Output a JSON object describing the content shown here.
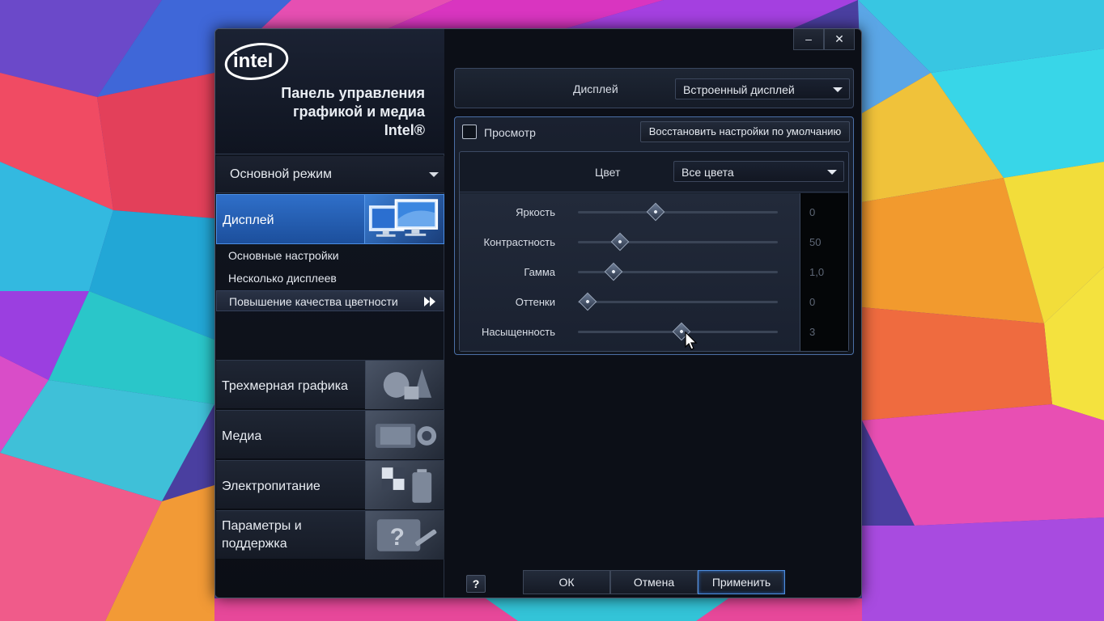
{
  "window": {
    "title_lines": [
      "Панель управления",
      "графикой и медиа",
      "Intel®"
    ],
    "logo_text": "intel",
    "minimize_symbol": "–",
    "close_symbol": "✕"
  },
  "sidebar": {
    "mode_label": "Основной режим",
    "active_section": "Дисплей",
    "sub_items": [
      {
        "label": "Основные настройки",
        "active": false
      },
      {
        "label": "Несколько дисплеев",
        "active": false
      },
      {
        "label": "Повышение качества цветности",
        "active": true
      }
    ],
    "sections": [
      {
        "label": "Трехмерная графика",
        "icon": "3d-shapes-icon"
      },
      {
        "label": "Медиа",
        "icon": "video-camera-icon"
      },
      {
        "label": "Электропитание",
        "icon": "battery-icon"
      },
      {
        "label": "Параметры и поддержка",
        "icon": "help-tools-icon"
      }
    ]
  },
  "main": {
    "display_label": "Дисплей",
    "display_value": "Встроенный дисплей",
    "preview_label": "Просмотр",
    "preview_checked": false,
    "restore_label": "Восстановить настройки по умолчанию",
    "color_label": "Цвет",
    "color_value": "Все цвета",
    "sliders": [
      {
        "label": "Яркость",
        "value": "0",
        "position": 0.39
      },
      {
        "label": "Контрастность",
        "value": "50",
        "position": 0.21
      },
      {
        "label": "Гамма",
        "value": "1,0",
        "position": 0.18
      },
      {
        "label": "Оттенки",
        "value": "0",
        "position": 0.05
      },
      {
        "label": "Насыщенность",
        "value": "3",
        "position": 0.52
      }
    ]
  },
  "footer": {
    "help_label": "?",
    "ok_label": "ОК",
    "cancel_label": "Отмена",
    "apply_label": "Применить"
  },
  "colors": {
    "accent": "#2f6fc9",
    "window_bg": "#0c0f17",
    "text": "#e4e8ef",
    "value_text": "#5e6776"
  }
}
